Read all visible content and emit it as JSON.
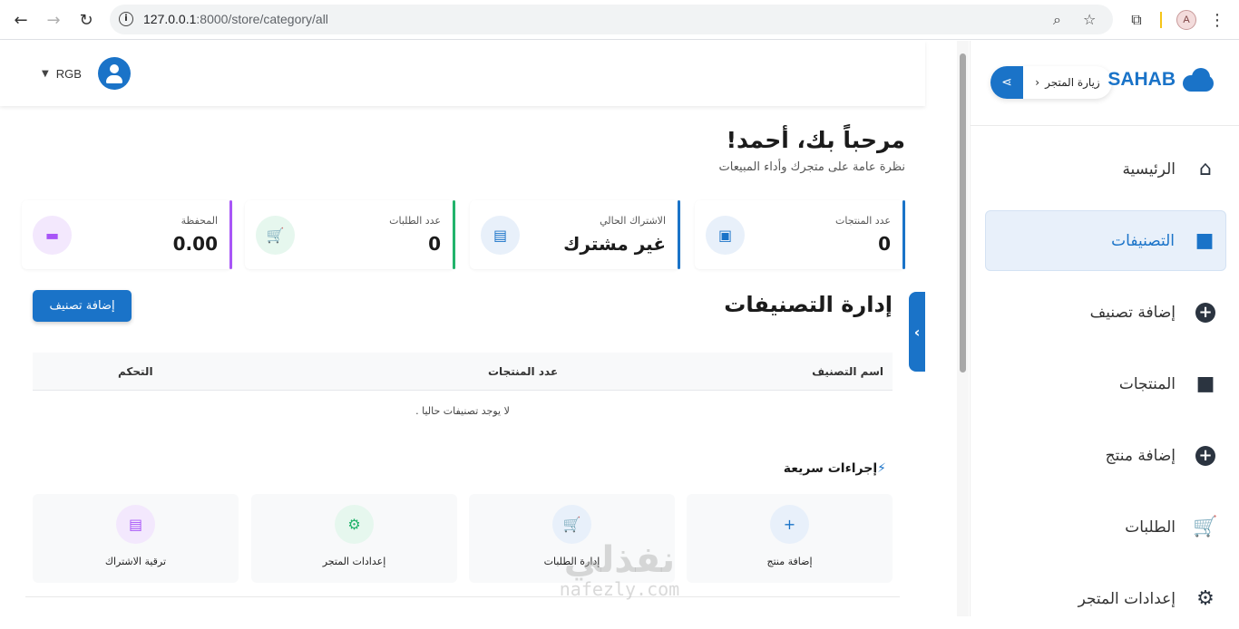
{
  "browser": {
    "url_host": "127.0.0.1",
    "url_path": ":8000/store/category/all",
    "profile_initial": "A"
  },
  "sidebar": {
    "brand": "SAHAB",
    "visit_store": "زيارة المتجر",
    "items": [
      {
        "label": "الرئيسية",
        "icon": "home-icon",
        "active": false
      },
      {
        "label": "التصنيفات",
        "icon": "bag-icon",
        "active": true
      },
      {
        "label": "إضافة تصنيف",
        "icon": "plus-circle-icon",
        "active": false
      },
      {
        "label": "المنتجات",
        "icon": "bag-icon",
        "active": false
      },
      {
        "label": "إضافة منتج",
        "icon": "plus-circle-icon",
        "active": false
      },
      {
        "label": "الطلبات",
        "icon": "cart-icon",
        "active": false
      },
      {
        "label": "إعدادات المتجر",
        "icon": "gear-icon",
        "active": false
      }
    ]
  },
  "topbar": {
    "username": "RGB"
  },
  "welcome": {
    "title": "مرحباً بك، أحمد!",
    "subtitle": "نظرة عامة على متجرك وأداء المبيعات"
  },
  "stats": [
    {
      "label": "عدد المنتجات",
      "value": "0",
      "color": "#1a73c8",
      "icon": "box-icon"
    },
    {
      "label": "الاشتراك الحالي",
      "value": "غير مشترك",
      "color": "#1a73c8",
      "icon": "id-card-icon"
    },
    {
      "label": "عدد الطلبات",
      "value": "0",
      "color": "#22b36b",
      "icon": "cart-icon"
    },
    {
      "label": "المحفظة",
      "value": "0.00",
      "color": "#a855f7",
      "icon": "wallet-icon"
    }
  ],
  "categories": {
    "title": "إدارة التصنيفات",
    "add_button": "إضافة تصنيف",
    "columns": [
      "اسم التصنيف",
      "عدد المنتجات",
      "التحكم"
    ],
    "empty_message": "لا يوجد تصنيفات حاليا ."
  },
  "quick_actions": {
    "title": "إجراءات سريعة",
    "items": [
      {
        "label": "إضافة منتج",
        "icon": "plus-icon"
      },
      {
        "label": "إدارة الطلبات",
        "icon": "cart-icon"
      },
      {
        "label": "إعدادات المتجر",
        "icon": "gear-icon"
      },
      {
        "label": "ترقية الاشتراك",
        "icon": "id-card-icon"
      }
    ]
  },
  "watermark": {
    "line1": "نفذلي",
    "line2": "nafezly.com"
  }
}
